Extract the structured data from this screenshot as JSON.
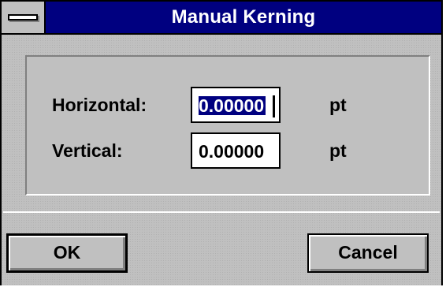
{
  "window": {
    "title": "Manual Kerning"
  },
  "fields": {
    "horizontal": {
      "label": "Horizontal:",
      "value": "0.00000",
      "unit": "pt",
      "selected": true
    },
    "vertical": {
      "label": "Vertical:",
      "value": "0.00000",
      "unit": "pt"
    }
  },
  "buttons": {
    "ok_label": "OK",
    "cancel_label": "Cancel"
  },
  "icons": {
    "system_menu": "system-menu-icon"
  },
  "colors": {
    "titlebar": "#000080",
    "face": "#c0c0c0",
    "selection": "#000080"
  }
}
